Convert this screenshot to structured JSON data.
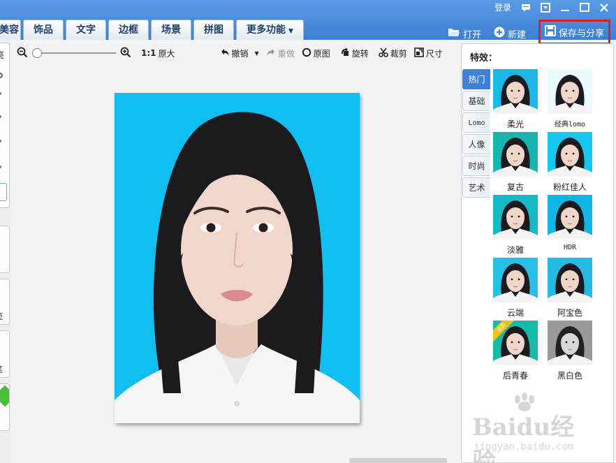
{
  "window": {
    "login_label": "登录"
  },
  "tabs": [
    "美容",
    "饰品",
    "文字",
    "边框",
    "场景",
    "拼图",
    "更多功能"
  ],
  "top_actions": {
    "open": "打开",
    "new": "新建",
    "save_share": "保存与分享"
  },
  "toolbar": {
    "actual_size": "1:1",
    "actual_size_label": "原大",
    "undo": "撤销",
    "redo": "重做",
    "original": "原图",
    "rotate": "旋转",
    "crop": "裁剪",
    "size": "尺寸",
    "zoom_level": 0
  },
  "left_strip": {
    "label_a": "亮",
    "label_b": "笔"
  },
  "effects_panel": {
    "title": "特效：",
    "categories": [
      "热门",
      "基础",
      "Lomo",
      "人像",
      "时尚",
      "艺术"
    ],
    "active_category": "热门",
    "items": [
      {
        "label": "柔光",
        "bg": "#1ab8ea"
      },
      {
        "label": "经典lomo",
        "bg": "#eafaff"
      },
      {
        "label": "复古",
        "bg": "#17b5b0"
      },
      {
        "label": "粉红佳人",
        "bg": "#15c7ec"
      },
      {
        "label": "淡雅",
        "bg": "#18b9c6"
      },
      {
        "label": "HDR",
        "bg": "#11b6e6"
      },
      {
        "label": "云端",
        "bg": "#29bfe8"
      },
      {
        "label": "阿宝色",
        "bg": "#26b9e1"
      },
      {
        "label": "后青春",
        "bg": "#17b9a8"
      },
      {
        "label": "黑白色",
        "bg": "#9a9a9a"
      }
    ],
    "vip_badge": "会员"
  },
  "watermark": {
    "brand": "Baidu经验",
    "url": "jingyan.baidu.com"
  }
}
